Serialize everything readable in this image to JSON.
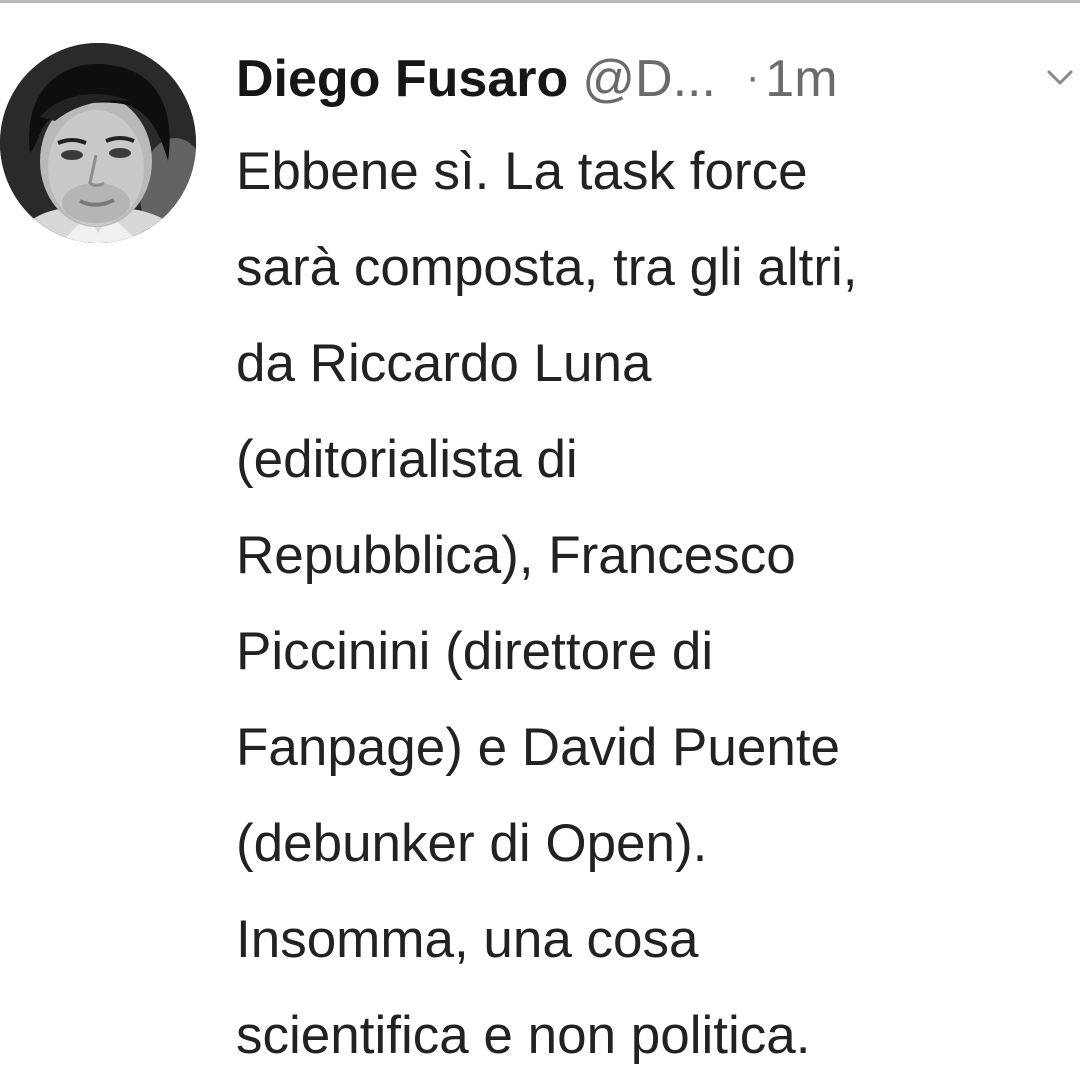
{
  "tweet": {
    "author_name": "Diego Fusaro",
    "handle": "@D...",
    "separator": "·",
    "time": "1m",
    "text_lines": [
      "Ebbene sì. La task force",
      "sarà composta, tra gli altri,",
      "da Riccardo Luna",
      "(editorialista di",
      "Repubblica), Francesco",
      "Piccinini (direttore di",
      "Fanpage) e David Puente",
      "(debunker di Open).",
      "Insomma, una cosa",
      "scientifica e non politica."
    ]
  },
  "icons": {
    "avatar": "profile-photo",
    "menu": "chevron-down-icon"
  },
  "colors": {
    "text": "#222222",
    "muted": "#6b6b6b",
    "background": "#ffffff"
  }
}
